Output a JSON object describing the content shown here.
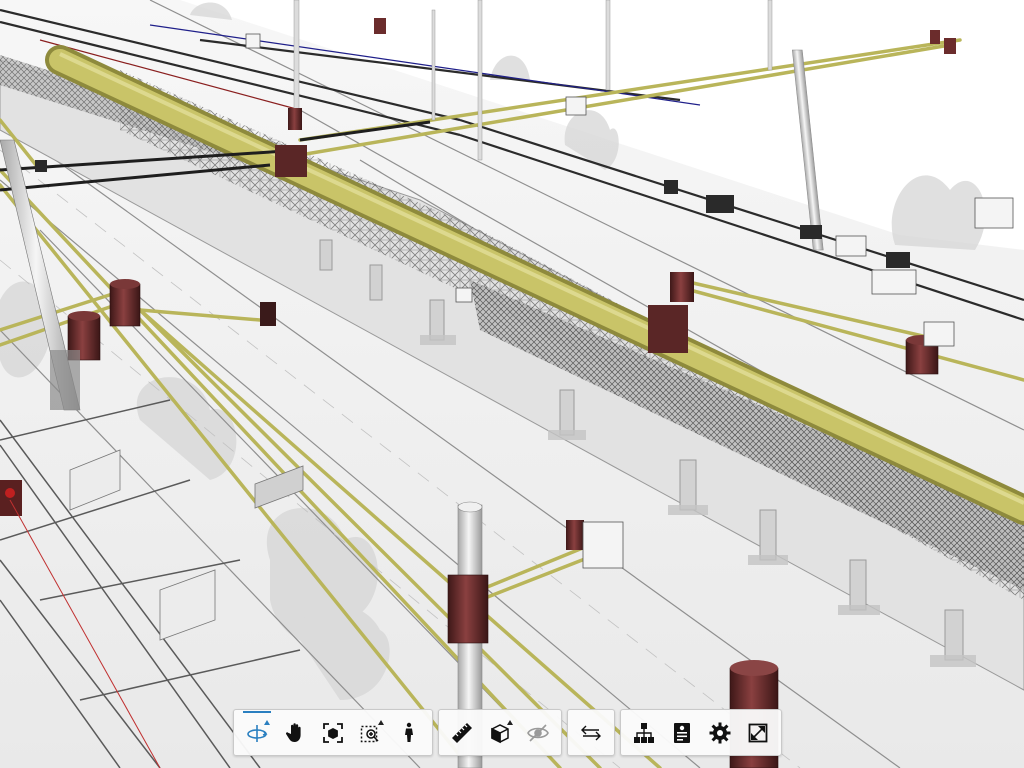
{
  "viewer": {
    "background": "#f2f2f2",
    "colors": {
      "conduit": "#c9c468",
      "conduit_dark": "#8e8a3c",
      "cylinder": "#6b2c2c",
      "pole": "#e4e4e4",
      "steel": "#3a3a3a",
      "ground_line": "#9a9a9a",
      "accent": "#2a7fc0"
    }
  },
  "toolbar": {
    "groups": [
      {
        "name": "navigation",
        "buttons": [
          {
            "id": "orbit",
            "icon": "orbit-icon",
            "active": true
          },
          {
            "id": "pan",
            "icon": "pan-hand-icon",
            "active": false
          },
          {
            "id": "fit-view",
            "icon": "fit-view-icon",
            "active": false
          },
          {
            "id": "zoom-window",
            "icon": "zoom-window-icon",
            "active": false
          },
          {
            "id": "first-person",
            "icon": "first-person-icon",
            "active": false
          }
        ]
      },
      {
        "name": "tools",
        "buttons": [
          {
            "id": "measure",
            "icon": "ruler-icon",
            "active": false
          },
          {
            "id": "section",
            "icon": "section-box-icon",
            "active": false
          },
          {
            "id": "visibility",
            "icon": "hide-eye-icon",
            "active": false
          }
        ]
      },
      {
        "name": "compare",
        "buttons": [
          {
            "id": "swap",
            "icon": "swap-arrows-icon",
            "active": false
          }
        ]
      },
      {
        "name": "panels",
        "buttons": [
          {
            "id": "model-tree",
            "icon": "model-tree-icon",
            "active": false
          },
          {
            "id": "properties",
            "icon": "properties-icon",
            "active": false
          },
          {
            "id": "settings",
            "icon": "gear-icon",
            "active": false
          },
          {
            "id": "fullscreen",
            "icon": "fullscreen-icon",
            "active": false
          }
        ]
      }
    ]
  }
}
